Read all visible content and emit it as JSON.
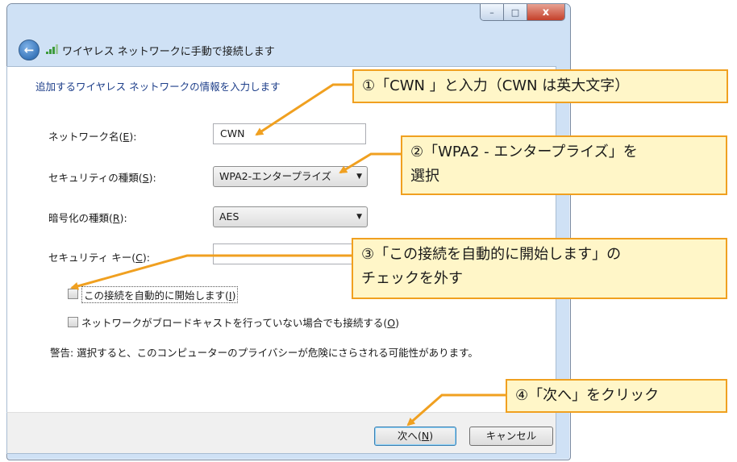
{
  "window": {
    "title": "ワイヤレス ネットワークに手動で接続します",
    "controls": {
      "minimize": "–",
      "maximize": "□",
      "close": "x"
    }
  },
  "form": {
    "intro": "追加するワイヤレス ネットワークの情報を入力します",
    "network_name_label": "ネットワーク名",
    "network_name_key": "E",
    "network_name_value": "CWN",
    "security_type_label": "セキュリティの種類",
    "security_type_key": "S",
    "security_type_value": "WPA2-エンタープライズ",
    "encryption_type_label": "暗号化の種類",
    "encryption_type_key": "R",
    "encryption_type_value": "AES",
    "security_key_label": "セキュリティ キー",
    "security_key_key": "C",
    "security_key_value": "",
    "auto_connect_label": "この接続を自動的に開始します",
    "auto_connect_key": "I",
    "auto_connect_checked": false,
    "hidden_network_label": "ネットワークがブロードキャストを行っていない場合でも接続する",
    "hidden_network_key": "O",
    "hidden_network_checked": false,
    "warning": "警告: 選択すると、このコンピューターのプライバシーが危険にさらされる可能性があります。"
  },
  "buttons": {
    "next_label": "次へ",
    "next_key": "N",
    "cancel_label": "キャンセル"
  },
  "callouts": {
    "c1": "①「CWN 」と入力（CWN は英大文字）",
    "c2_line1": "②「WPA2 - エンタープライズ」を",
    "c2_line2": "選択",
    "c3_line1": "③「この接続を自動的に開始します」の",
    "c3_line2": "チェックを外す",
    "c4": "④「次へ」をクリック"
  },
  "colors": {
    "callout_fill": "#fff6c8",
    "callout_border": "#f0a020",
    "arrow": "#f0a020",
    "intro_text": "#1e3f8a"
  },
  "icons": {
    "back": "back-arrow-icon",
    "wifi": "wireless-signal-icon",
    "dropdown": "chevron-down-icon"
  }
}
